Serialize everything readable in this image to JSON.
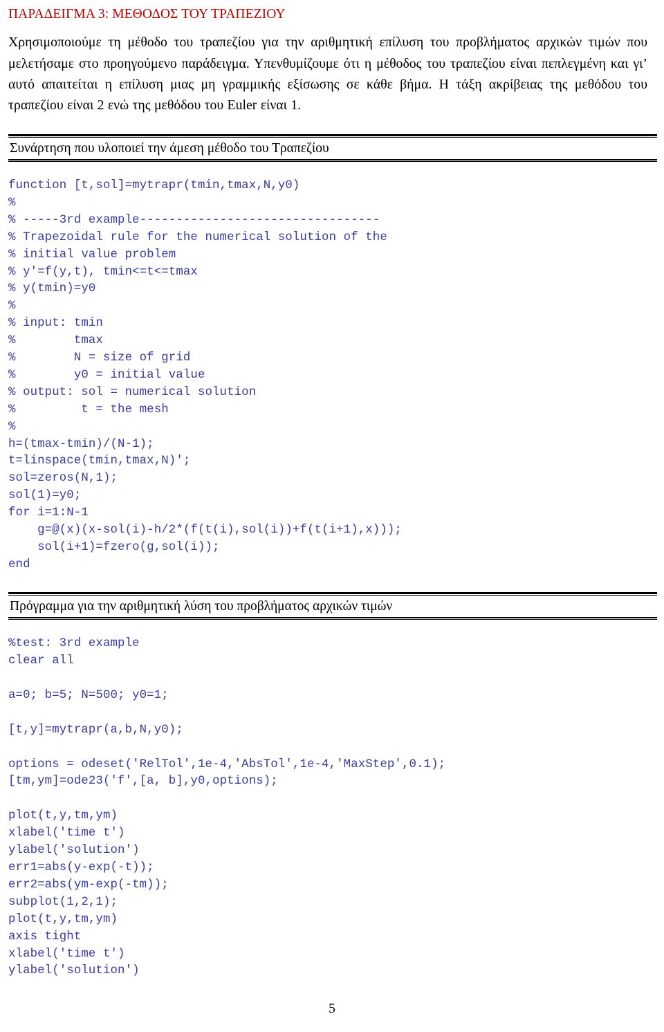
{
  "document": {
    "title": "ΠΑΡΑΔΕΙΓΜΑ 3: ΜΕΘΟΔΟΣ ΤΟΥ ΤΡΑΠΕΖΙΟΥ",
    "title_color": "#c00000",
    "code_color": "#3b3b9e",
    "page_number": "5"
  },
  "intro": {
    "paragraph": "Χρησιμοποιούμε τη μέθοδο του τραπεζίου για την αριθμητική επίλυση του προβλήματος αρχικών τιμών που μελετήσαμε στο προηγούμενο παράδειγμα. Υπενθυμίζουμε ότι η μέθοδος του τραπεζίου είναι πεπλεγμένη και γι’ αυτό απαιτείται η επίλυση μιας μη γραμμικής εξίσωσης σε κάθε βήμα. Η τάξη ακρίβειας της μεθόδου του τραπεζίου είναι 2 ενώ της μεθόδου του Euler είναι 1."
  },
  "sections": [
    {
      "heading": "Συνάρτηση που υλοποιεί την άμεση μέθοδο του Τραπεζίου",
      "code": [
        "function [t,sol]=mytrapr(tmin,tmax,N,y0)",
        "%",
        "% -----3rd example---------------------------------",
        "% Trapezoidal rule for the numerical solution of the",
        "% initial value problem",
        "% y'=f(y,t), tmin<=t<=tmax",
        "% y(tmin)=y0",
        "%",
        "% input: tmin",
        "%        tmax",
        "%        N = size of grid",
        "%        y0 = initial value",
        "% output: sol = numerical solution",
        "%         t = the mesh",
        "%",
        "h=(tmax-tmin)/(N-1);",
        "t=linspace(tmin,tmax,N)';",
        "sol=zeros(N,1);",
        "sol(1)=y0;",
        "for i=1:N-1",
        "    g=@(x)(x-sol(i)-h/2*(f(t(i),sol(i))+f(t(i+1),x)));",
        "    sol(i+1)=fzero(g,sol(i));",
        "end"
      ]
    },
    {
      "heading": "Πρόγραμμα για την αριθμητική λύση του προβλήματος αρχικών τιμών",
      "code": [
        "%test: 3rd example",
        "clear all",
        "",
        "a=0; b=5; N=500; y0=1;",
        "",
        "[t,y]=mytrapr(a,b,N,y0);",
        "",
        "options = odeset('RelTol',1e-4,'AbsTol',1e-4,'MaxStep',0.1);",
        "[tm,ym]=ode23('f',[a, b],y0,options);",
        "",
        "plot(t,y,tm,ym)",
        "xlabel('time t')",
        "ylabel('solution')",
        "err1=abs(y-exp(-t));",
        "err2=abs(ym-exp(-tm));",
        "subplot(1,2,1);",
        "plot(t,y,tm,ym)",
        "axis tight",
        "xlabel('time t')",
        "ylabel('solution')"
      ]
    }
  ]
}
